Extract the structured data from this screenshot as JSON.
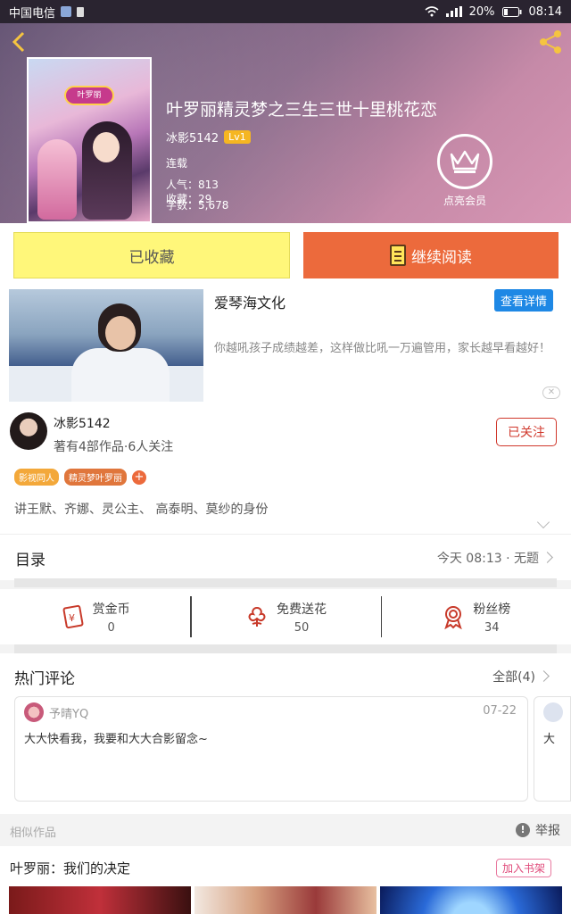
{
  "status_bar": {
    "carrier": "中国电信",
    "battery": "20%",
    "time": "08:14"
  },
  "book": {
    "title": "叶罗丽精灵梦之三生三世十里桃花恋",
    "author": "冰影5142",
    "level": "Lv1",
    "status": "连载",
    "popularity_label": "人气：",
    "popularity": "813",
    "words_label": "字数：",
    "words": "5,678",
    "favorites_label": "收藏：",
    "favorites": "29",
    "cover_logo": "叶罗丽"
  },
  "vip": {
    "label": "点亮会员"
  },
  "actions": {
    "favorited_label": "已收藏",
    "continue_label": "继续阅读"
  },
  "ad": {
    "title": "爱琴海文化",
    "detail_label": "查看详情",
    "description": "你越吼孩子成绩越差，这样做比吼一万遍管用，家长越早看越好！",
    "close_label": "✕"
  },
  "author_card": {
    "name": "冰影5142",
    "stats": "著有4部作品·6人关注",
    "follow_label": "已关注",
    "tags": [
      "影视同人",
      "精灵梦叶罗丽"
    ],
    "tag_add": "+",
    "summary": "讲王默、齐娜、灵公主、 高泰明、莫纱的身份"
  },
  "toc": {
    "label": "目录",
    "update": "今天 08:13 · 无题"
  },
  "stats": {
    "reward_label": "赏金币",
    "reward_value": "0",
    "flower_label": "免费送花",
    "flower_value": "50",
    "fans_label": "粉丝榜",
    "fans_value": "34"
  },
  "comments": {
    "title": "热门评论",
    "all_label": "全部(4)",
    "items": [
      {
        "user": "予晴YQ",
        "date": "07-22",
        "text": "大大快看我，我要和大大合影留念~"
      },
      {
        "text": "大"
      }
    ]
  },
  "similar": {
    "label": "相似作品",
    "report_label": "举报",
    "rec_title": "叶罗丽：我们的决定",
    "add_shelf_label": "加入书架"
  },
  "colors": {
    "accent_orange": "#ec6a3c",
    "fav_yellow": "#fff77a",
    "follow_red": "#d0382c",
    "detail_blue": "#1e88e5"
  }
}
